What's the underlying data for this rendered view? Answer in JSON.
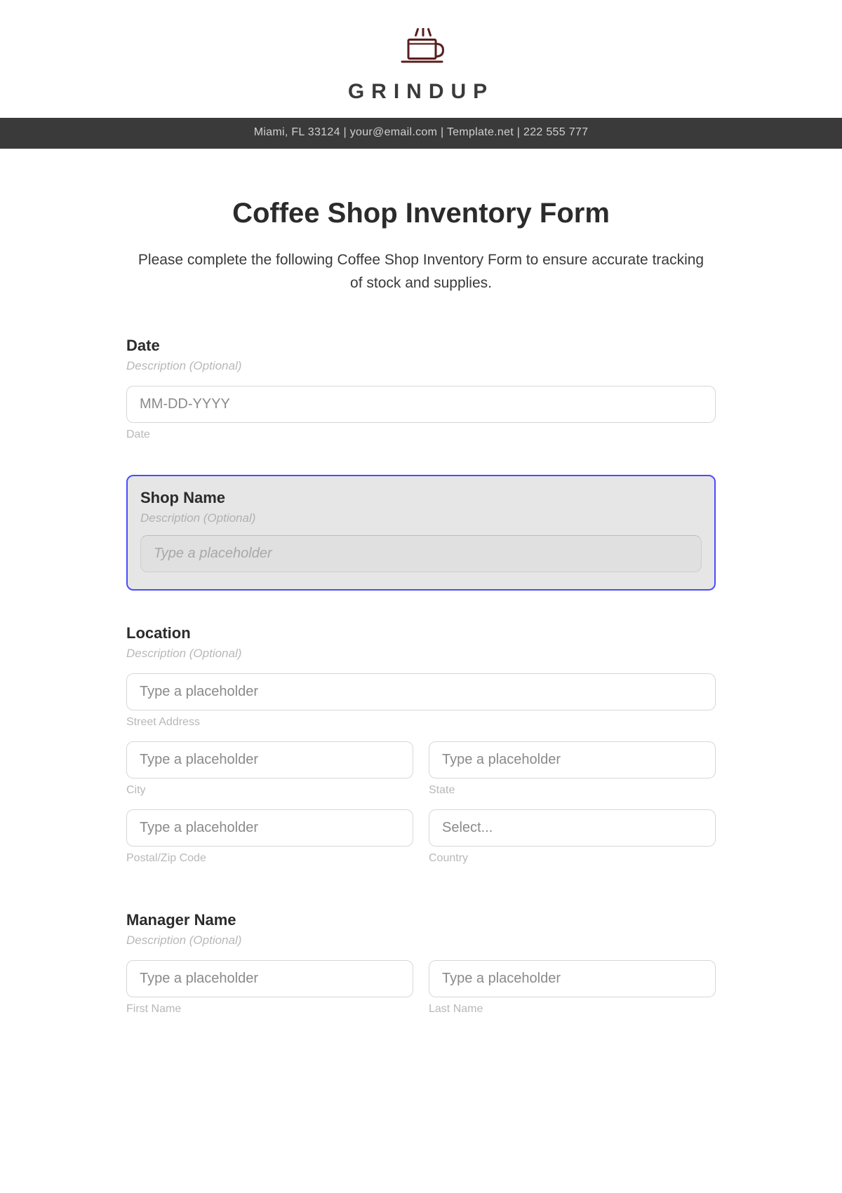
{
  "brand": {
    "name": "GRINDUP",
    "info_bar": "Miami, FL 33124 | your@email.com | Template.net | 222 555 777"
  },
  "form": {
    "title": "Coffee Shop Inventory Form",
    "intro": "Please complete the following Coffee Shop Inventory Form to ensure accurate tracking of stock and supplies."
  },
  "sections": {
    "date": {
      "label": "Date",
      "desc": "Description (Optional)",
      "placeholder": "MM-DD-YYYY",
      "sublabel": "Date"
    },
    "shop": {
      "label": "Shop Name",
      "desc": "Description (Optional)",
      "placeholder": "Type a placeholder"
    },
    "location": {
      "label": "Location",
      "desc": "Description (Optional)",
      "street": {
        "placeholder": "Type a placeholder",
        "sublabel": "Street Address"
      },
      "city": {
        "placeholder": "Type a placeholder",
        "sublabel": "City"
      },
      "state": {
        "placeholder": "Type a placeholder",
        "sublabel": "State"
      },
      "postal": {
        "placeholder": "Type a placeholder",
        "sublabel": "Postal/Zip Code"
      },
      "country": {
        "placeholder": "Select...",
        "sublabel": "Country"
      }
    },
    "manager": {
      "label": "Manager Name",
      "desc": "Description (Optional)",
      "first": {
        "placeholder": "Type a placeholder",
        "sublabel": "First Name"
      },
      "last": {
        "placeholder": "Type a placeholder",
        "sublabel": "Last Name"
      }
    }
  }
}
